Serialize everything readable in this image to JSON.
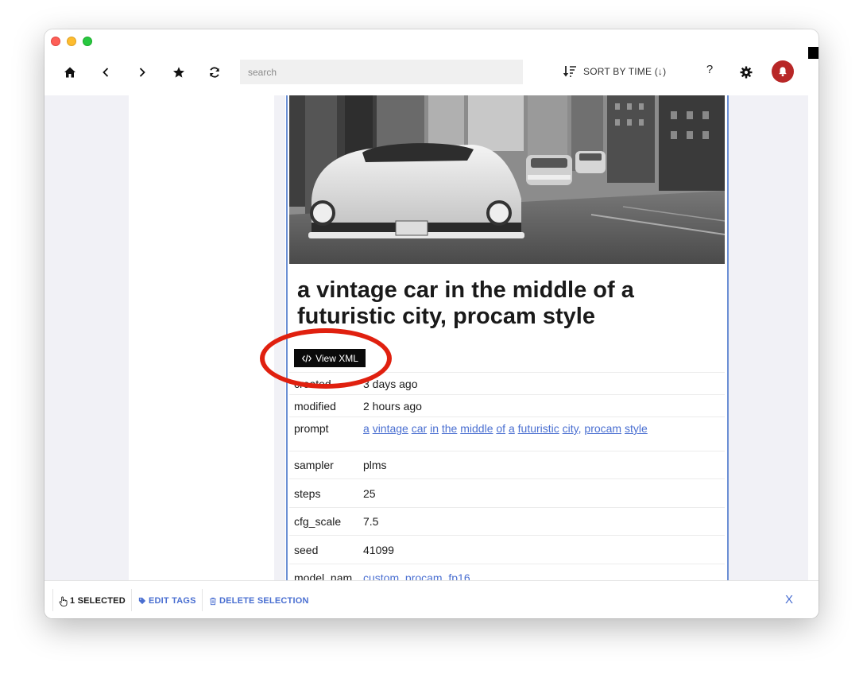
{
  "toolbar": {
    "search_placeholder": "search",
    "sort_label": "SORT BY TIME (↓)",
    "help_label": "?"
  },
  "item": {
    "title": "a vintage car in the middle of a futuristic city, procam style",
    "view_xml_label": "View XML",
    "meta": {
      "created_label": "created",
      "created_value": "3 days ago",
      "modified_label": "modified",
      "modified_value": "2 hours ago",
      "prompt_label": "prompt",
      "prompt_words": [
        "a",
        "vintage",
        "car",
        "in",
        "the",
        "middle",
        "of",
        "a",
        "futuristic",
        "city,",
        "procam",
        "style"
      ],
      "sampler_label": "sampler",
      "sampler_value": "plms",
      "steps_label": "steps",
      "steps_value": "25",
      "cfg_label": "cfg_scale",
      "cfg_value": "7.5",
      "seed_label": "seed",
      "seed_value": "41099",
      "model_label": "model_nam",
      "model_value": "custom_procam_fp16"
    }
  },
  "bottombar": {
    "selected_label": "1 SELECTED",
    "edit_tags_label": "EDIT TAGS",
    "delete_label": "DELETE SELECTION",
    "close_label": "X"
  },
  "colors": {
    "accent": "#4a6fd1",
    "card_border": "#6b8fd4",
    "notification": "#b82727",
    "annotation": "#e0200f",
    "sidebar_bg": "#f1f1f6"
  }
}
